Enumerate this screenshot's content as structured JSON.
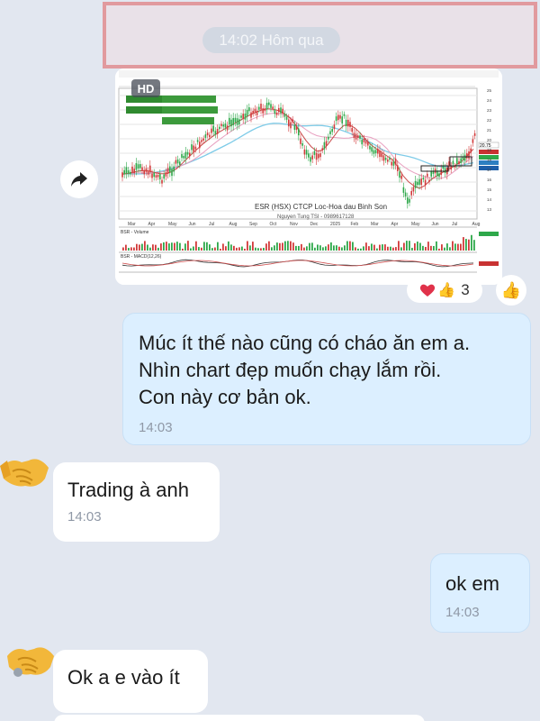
{
  "date_separator": "14:02 Hôm qua",
  "colors": {
    "background": "#e2e7f0",
    "sent_bubble": "#dcefff",
    "received_bubble": "#ffffff",
    "highlight": "#e19a9e",
    "time_text": "#8f98a6"
  },
  "shared_image": {
    "badge": "HD",
    "chart_title": "ESR (HSX) CTCP Loc-Hoa dau Binh Son",
    "author_line": "Nguyen Tung TSI - 0989617128",
    "x_labels": [
      "Mar",
      "Apr",
      "May",
      "Jun",
      "Jul",
      "Aug",
      "Sep",
      "Oct",
      "Nov",
      "Dec",
      "2025",
      "Feb",
      "Mar",
      "Apr",
      "May",
      "Jun",
      "Jul",
      "Aug"
    ],
    "price_labels": [
      "25",
      "24",
      "23",
      "22",
      "21",
      "20",
      "19",
      "18",
      "17",
      "16",
      "15",
      "14",
      "13"
    ],
    "last_price": "20.75",
    "volume_label": "BSR - Volume",
    "macd_label": "BSR - MACD(12,26)"
  },
  "reactions": {
    "icons": [
      "heart-icon",
      "thumbs-up-icon"
    ],
    "count": "3"
  },
  "messages": [
    {
      "direction": "sent",
      "text": "Múc ít thế nào cũng có cháo ăn em a.\nNhìn chart đẹp muốn chạy lắm rồi.\nCon này cơ bản ok.",
      "time": "14:03"
    },
    {
      "direction": "received",
      "text": "Trading à anh",
      "time": "14:03"
    },
    {
      "direction": "sent",
      "text": "ok em",
      "time": "14:03"
    },
    {
      "direction": "received",
      "text": "Ok a e vào ít",
      "time": ""
    }
  ]
}
